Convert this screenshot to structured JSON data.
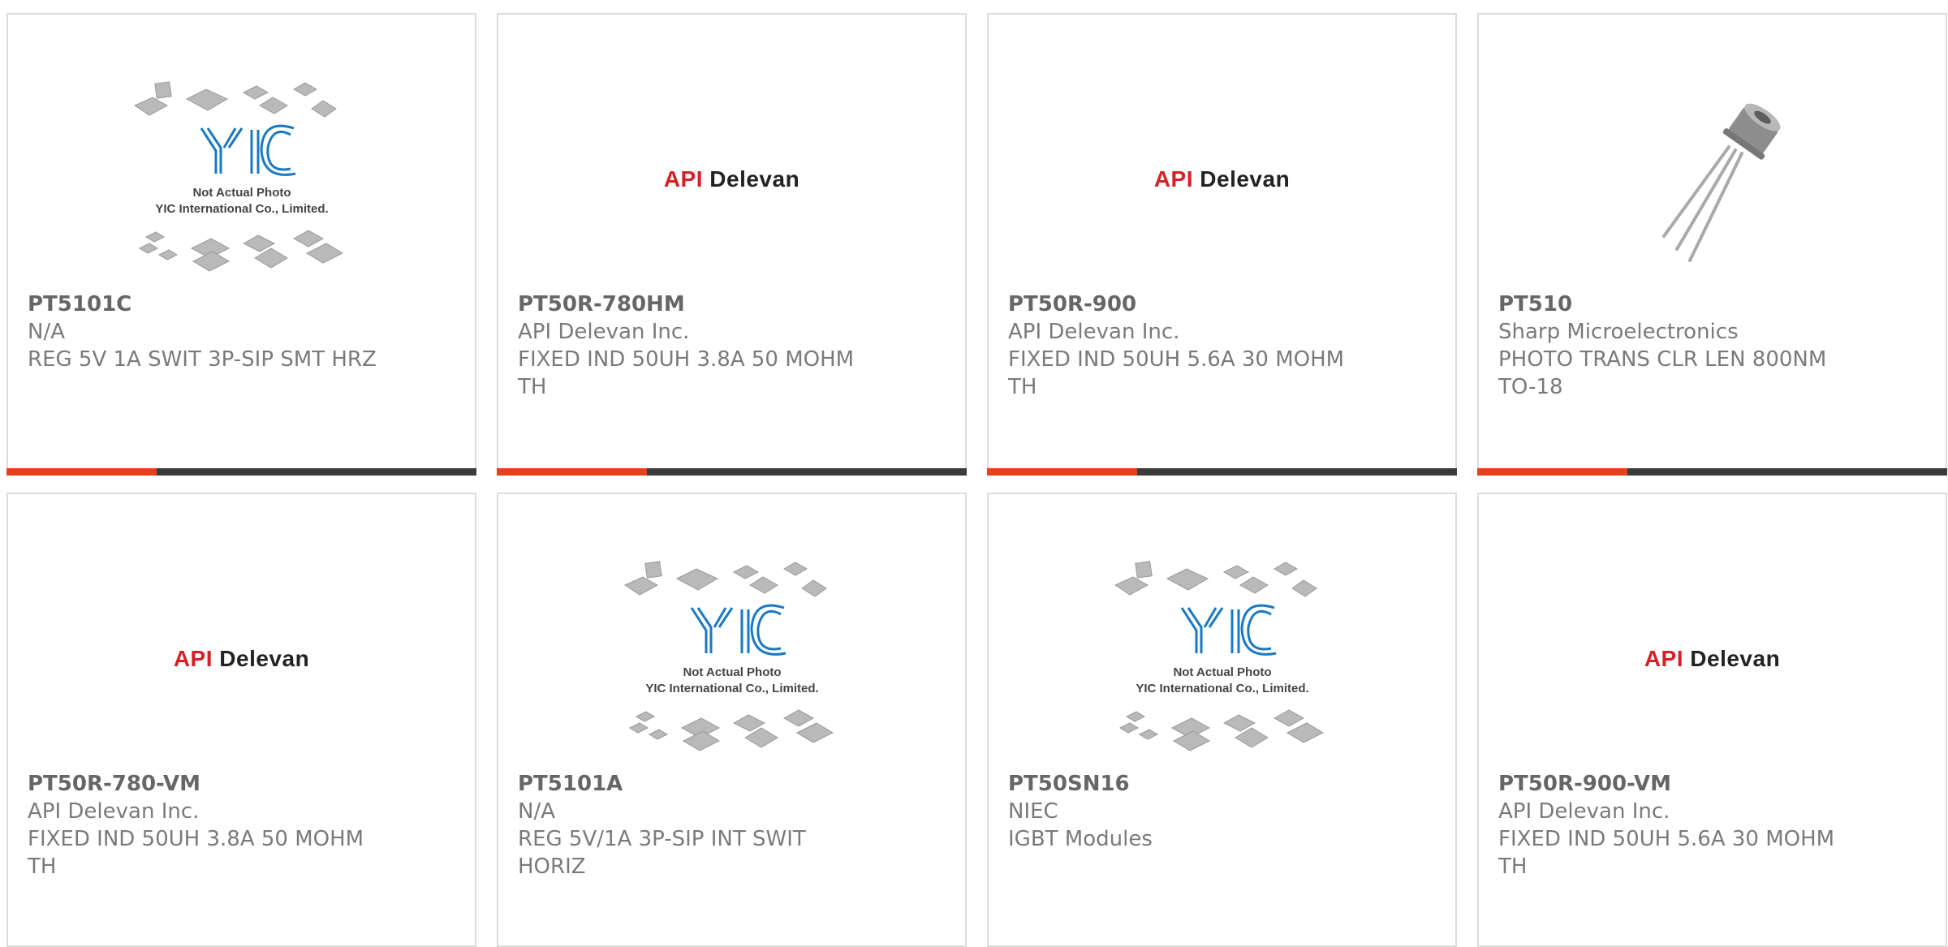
{
  "products": [
    {
      "part": "PT5101C",
      "mfr": "N/A",
      "desc": "REG 5V 1A SWIT 3P-SIP SMT HRZ",
      "image": "yic-placeholder"
    },
    {
      "part": "PT50R-780HM",
      "mfr": "API Delevan Inc.",
      "desc": "FIXED IND 50UH 3.8A 50 MOHM\nTH",
      "image": "api-delevan-logo"
    },
    {
      "part": "PT50R-900",
      "mfr": "API Delevan Inc.",
      "desc": "FIXED IND 50UH 5.6A 30 MOHM\nTH",
      "image": "api-delevan-logo"
    },
    {
      "part": "PT510",
      "mfr": "Sharp Microelectronics",
      "desc": "PHOTO TRANS CLR LEN 800NM\nTO-18",
      "image": "phototransistor-photo"
    },
    {
      "part": "PT50R-780-VM",
      "mfr": "API Delevan Inc.",
      "desc": "FIXED IND 50UH 3.8A 50 MOHM\nTH",
      "image": "api-delevan-logo"
    },
    {
      "part": "PT5101A",
      "mfr": "N/A",
      "desc": "REG 5V/1A 3P-SIP INT SWIT\nHORIZ",
      "image": "yic-placeholder"
    },
    {
      "part": "PT50SN16",
      "mfr": "NIEC",
      "desc": "IGBT Modules",
      "image": "yic-placeholder"
    },
    {
      "part": "PT50R-900-VM",
      "mfr": "API Delevan Inc.",
      "desc": "FIXED IND 50UH 5.6A 30 MOHM\nTH",
      "image": "api-delevan-logo"
    }
  ],
  "logo": {
    "api": "API",
    "delevan": "Delevan"
  },
  "placeholder": {
    "line1": "Not Actual Photo",
    "line2": "YIC International Co., Limited.",
    "brand": "YIC"
  },
  "colors": {
    "accent": "#e8401c",
    "bar": "#3b3b3b",
    "api_red": "#d71f26"
  }
}
